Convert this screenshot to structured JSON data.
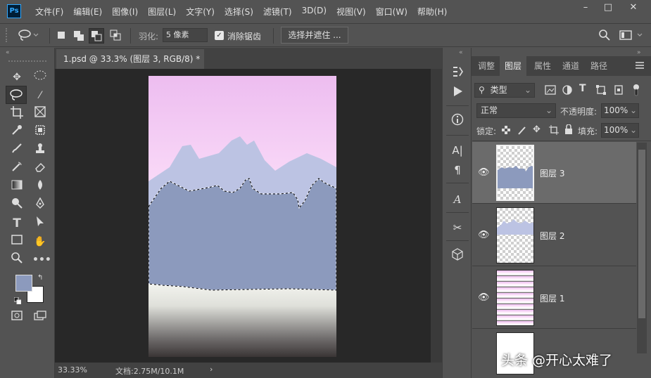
{
  "app": {
    "logo_text": "Ps"
  },
  "menu": [
    "文件(F)",
    "编辑(E)",
    "图像(I)",
    "图层(L)",
    "文字(Y)",
    "选择(S)",
    "滤镜(T)",
    "3D(D)",
    "视图(V)",
    "窗口(W)",
    "帮助(H)"
  ],
  "window_controls": {
    "minimize": "–",
    "maximize": "□",
    "close": "✕"
  },
  "options": {
    "feather_label": "羽化:",
    "feather_value": "5 像素",
    "antialias_label": "消除锯齿",
    "antialias_checked": true,
    "select_mask_label": "选择并遮住 ..."
  },
  "document": {
    "tab_title": "1.psd @ 33.3% (图层 3, RGB/8) *",
    "tab_close": "×",
    "zoom": "33.33%",
    "doc_size": "文档:2.75M/10.1M",
    "status_arrow": "›"
  },
  "colors": {
    "foreground": "#8c9abd",
    "background": "#ffffff"
  },
  "layers_panel": {
    "tabs": [
      "调整",
      "图层",
      "属性",
      "通道",
      "路径"
    ],
    "active_tab": "图层",
    "filter_kind": "类型",
    "blend_mode": "正常",
    "opacity_label": "不透明度:",
    "opacity_value": "100%",
    "lock_label": "锁定:",
    "fill_label": "填充:",
    "fill_value": "100%",
    "layers": [
      {
        "name": "图层 3",
        "selected": true
      },
      {
        "name": "图层 2",
        "selected": false
      },
      {
        "name": "图层 1",
        "selected": false
      },
      {
        "name": "",
        "selected": false
      }
    ]
  },
  "watermark": "头条 @开心太难了"
}
